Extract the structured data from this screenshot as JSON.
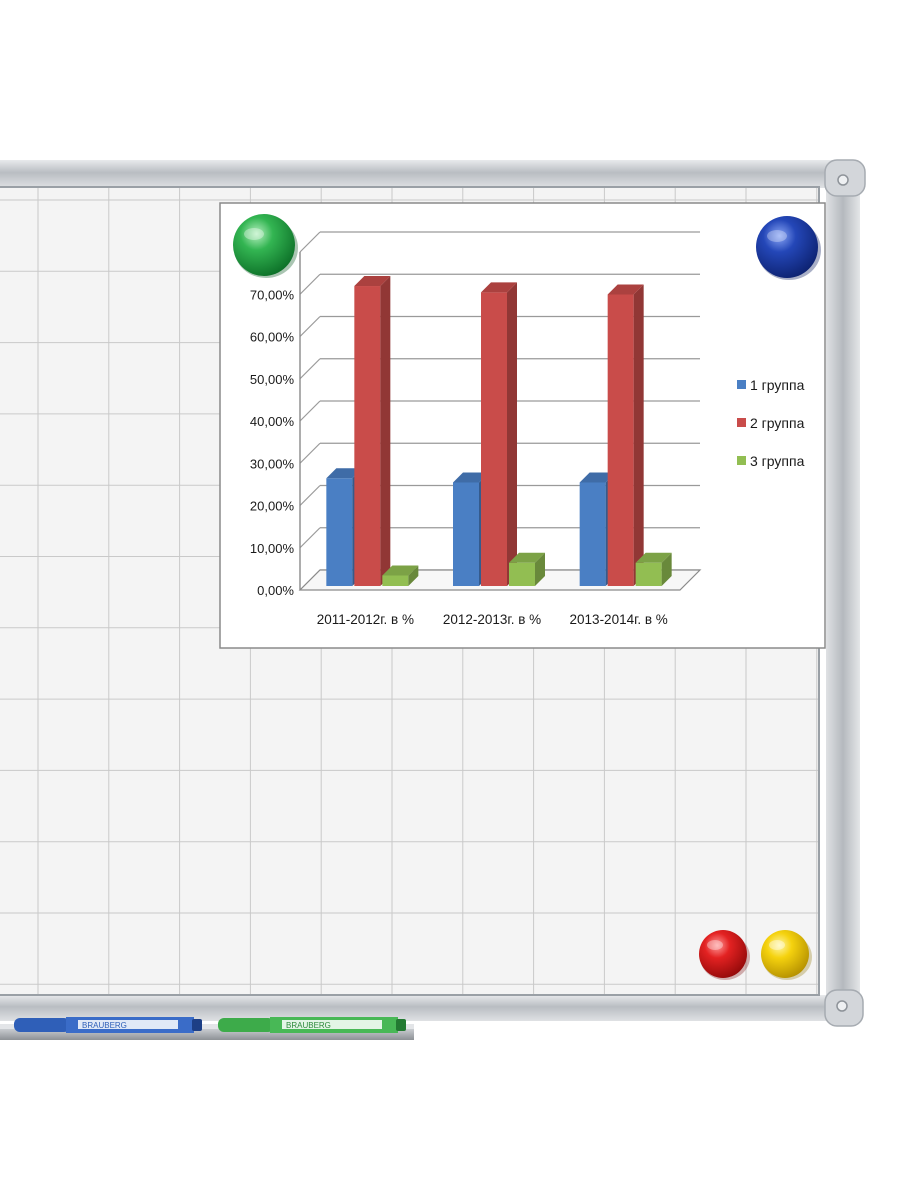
{
  "colors": {
    "background": "#ffffff",
    "board_surface": "#f4f4f4",
    "grid_line": "#c8c8c8",
    "frame": "#c9ccd0",
    "series_1": "#4a7fc4",
    "series_2": "#c94c4a",
    "series_3": "#92be52",
    "magnet_green": "#1fa345",
    "magnet_blue": "#1a3fa8",
    "magnet_red": "#d81d1d",
    "magnet_yellow": "#f2cf10",
    "marker_blue": "#2f5fb8",
    "marker_green": "#3dab4a"
  },
  "magnets": [
    {
      "color": "green",
      "icon": "magnet-green-icon"
    },
    {
      "color": "blue",
      "icon": "magnet-blue-icon"
    },
    {
      "color": "red",
      "icon": "magnet-red-icon"
    },
    {
      "color": "yellow",
      "icon": "magnet-yellow-icon"
    }
  ],
  "markers": [
    {
      "color": "blue",
      "brand": "BRAUBERG"
    },
    {
      "color": "green",
      "brand": "BRAUBERG"
    }
  ],
  "chart_data": {
    "type": "bar",
    "style": "3d-clustered-column",
    "categories": [
      "2011-2012г. в %",
      "2012-2013г. в %",
      "2013-2014г. в %"
    ],
    "series": [
      {
        "name": "1 группа",
        "values": [
          25.5,
          24.5,
          24.5
        ]
      },
      {
        "name": "2 группа",
        "values": [
          71.0,
          69.5,
          69.0
        ]
      },
      {
        "name": "3 группа",
        "values": [
          2.5,
          5.5,
          5.5
        ]
      }
    ],
    "y_ticks": [
      "0,00%",
      "10,00%",
      "20,00%",
      "30,00%",
      "40,00%",
      "50,00%",
      "60,00%",
      "70,00%"
    ],
    "ylim": [
      0,
      80
    ],
    "grid": true,
    "legend_position": "right"
  }
}
